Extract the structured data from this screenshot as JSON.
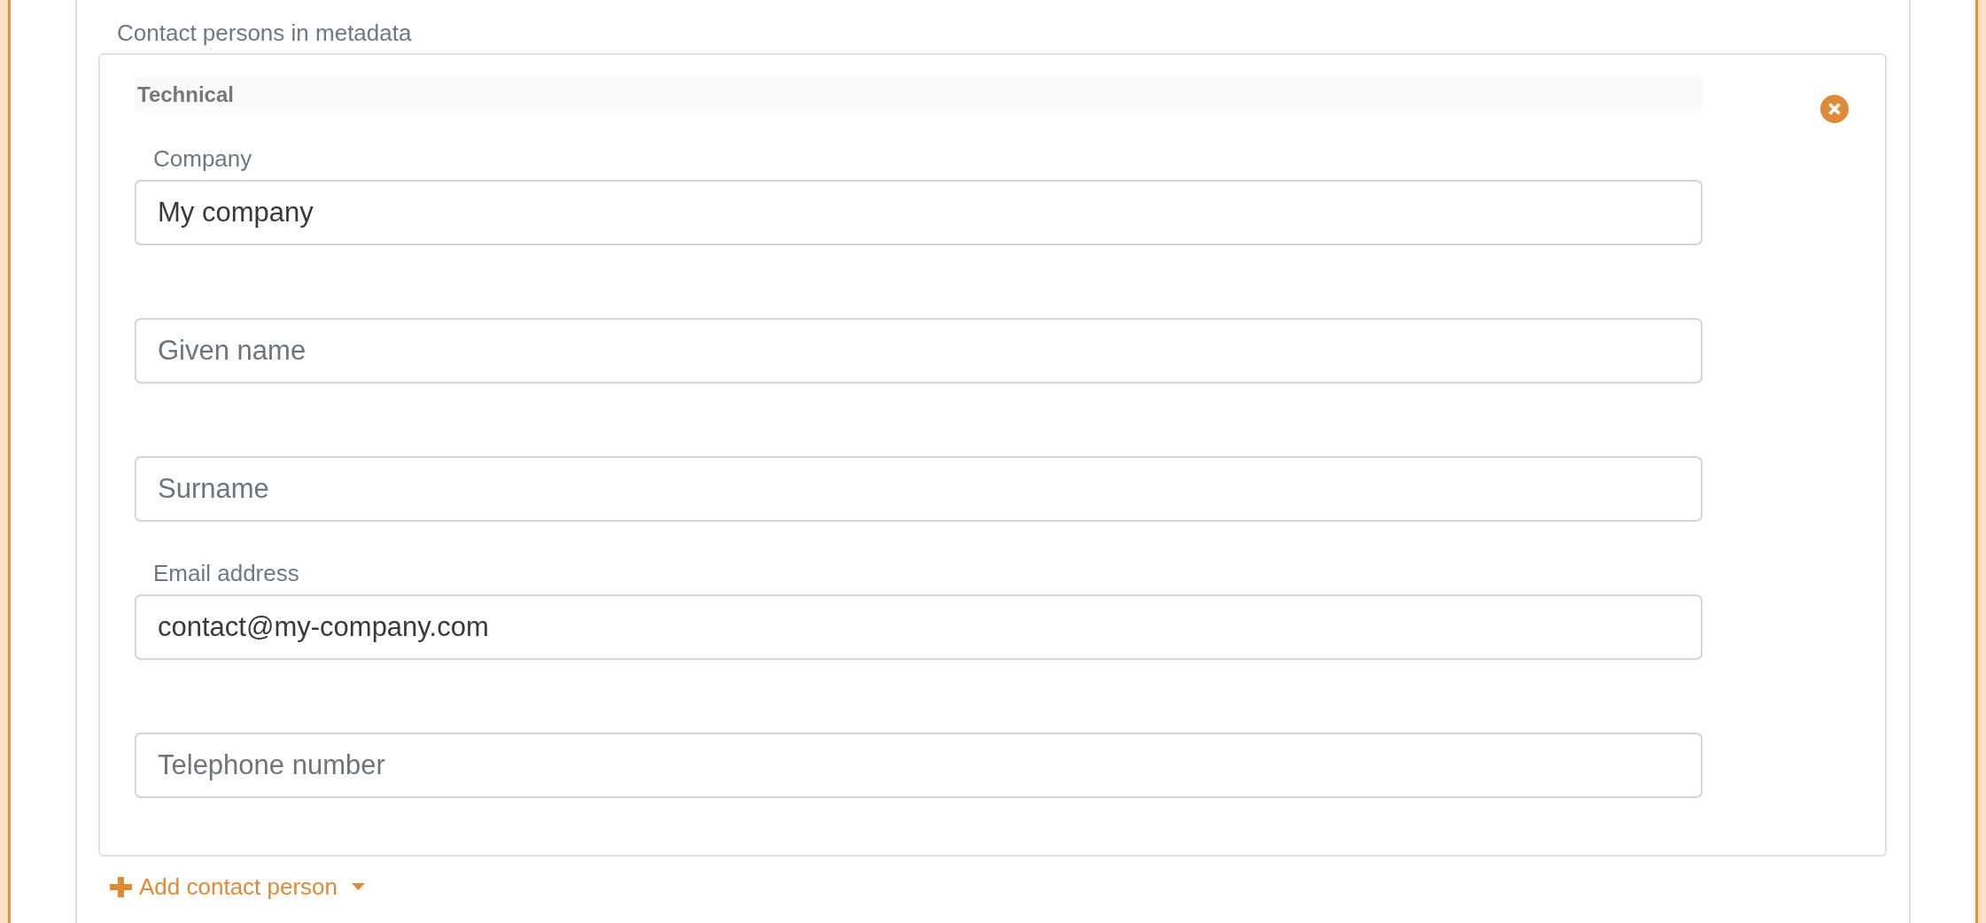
{
  "section": {
    "title": "Contact persons in metadata"
  },
  "contacts": [
    {
      "heading": "Technical",
      "fields": [
        {
          "label": "Company",
          "value": "My company"
        },
        {
          "placeholder": "Given name"
        },
        {
          "placeholder": "Surname"
        },
        {
          "label": "Email address",
          "value": "contact@my-company.com"
        },
        {
          "placeholder": "Telephone number"
        }
      ]
    }
  ],
  "add_button": {
    "label": "Add contact person"
  }
}
